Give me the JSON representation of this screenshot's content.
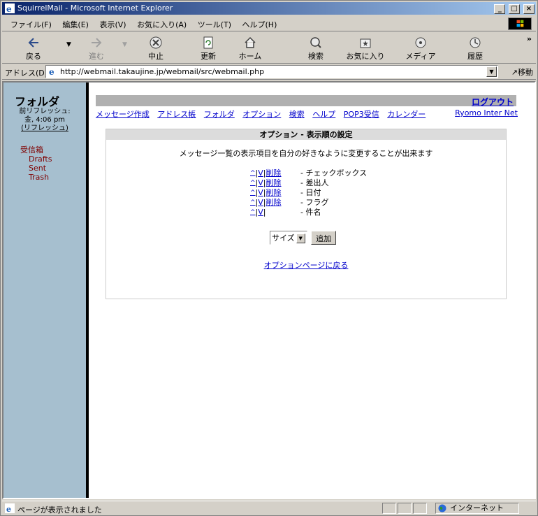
{
  "window": {
    "title": "SquirrelMail - Microsoft Internet Explorer",
    "min": "_",
    "max": "□",
    "close": "×"
  },
  "menu": [
    "ファイル(F)",
    "編集(E)",
    "表示(V)",
    "お気に入り(A)",
    "ツール(T)",
    "ヘルプ(H)"
  ],
  "toolbar": {
    "back": "戻る",
    "forward": "進む",
    "stop": "中止",
    "refresh": "更新",
    "home": "ホーム",
    "search": "検索",
    "favorites": "お気に入り",
    "media": "メディア",
    "history": "履歴",
    "more": "»"
  },
  "address": {
    "label": "アドレス(D)",
    "url": "http://webmail.takaujine.jp/webmail/src/webmail.php",
    "go": "移動"
  },
  "left": {
    "title": "フォルダ",
    "refresh_label": "前リフレッシュ:",
    "refresh_time": "金, 4:06 pm",
    "refresh_link": "(リフレッシュ)",
    "folders": [
      "受信箱",
      "Drafts",
      "Sent",
      "Trash"
    ]
  },
  "right": {
    "logout": "ログアウト",
    "nav": [
      "メッセージ作成",
      "アドレス帳",
      "フォルダ",
      "オプション",
      "検索",
      "ヘルプ",
      "POP3受信",
      "カレンダー"
    ],
    "nav_right": "Ryomo Inter Net",
    "header": "オプション - 表示順の設定",
    "description": "メッセージ一覧の表示項目を自分の好きなように変更することが出来ます",
    "up": "^",
    "down": "V",
    "delete": "削除",
    "rows": [
      {
        "label": "- チェックボックス",
        "deletable": true
      },
      {
        "label": "- 差出人",
        "deletable": true
      },
      {
        "label": "- 日付",
        "deletable": true
      },
      {
        "label": "- フラグ",
        "deletable": true
      },
      {
        "label": "- 件名",
        "deletable": false
      }
    ],
    "select_value": "サイズ",
    "add_button": "追加",
    "back_link": "オプションページに戻る"
  },
  "status": {
    "text": "ページが表示されました",
    "zone": "インターネット"
  },
  "colors": {
    "title_start": "#0a246a",
    "title_end": "#a6caf0",
    "folder_pane": "#a6bfcf",
    "link": "#0000cc",
    "folder_text": "#800000"
  }
}
